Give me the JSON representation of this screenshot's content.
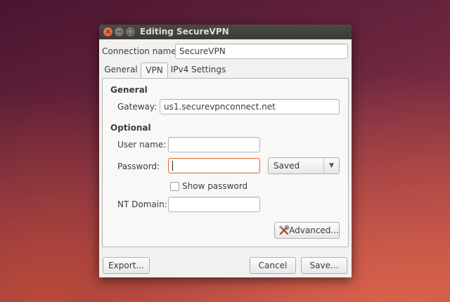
{
  "window": {
    "title": "Editing SecureVPN",
    "controls": {
      "close": "×",
      "minimize": "−",
      "maximize": "□"
    }
  },
  "connection": {
    "label": "Connection name:",
    "value": "SecureVPN"
  },
  "tabs": [
    {
      "label": "General",
      "active": false
    },
    {
      "label": "VPN",
      "active": true
    },
    {
      "label": "IPv4 Settings",
      "active": false
    }
  ],
  "vpn": {
    "general_heading": "General",
    "gateway": {
      "label": "Gateway:",
      "value": "us1.securevpnconnect.net"
    },
    "optional_heading": "Optional",
    "username": {
      "label": "User name:",
      "value": ""
    },
    "password": {
      "label": "Password:",
      "value": "",
      "storage": "Saved",
      "storage_arrow": "▼"
    },
    "show_password": {
      "label": "Show password",
      "checked": false
    },
    "nt_domain": {
      "label": "NT Domain:",
      "value": ""
    },
    "advanced_label": "Advanced..."
  },
  "footer": {
    "export_label": "Export...",
    "cancel_label": "Cancel",
    "save_label": "Save..."
  },
  "colors": {
    "accent": "#f07746",
    "titlebar": "#3c3b37",
    "window_bg": "#f2f1f0"
  },
  "icons": {
    "advanced": "tools-icon"
  }
}
